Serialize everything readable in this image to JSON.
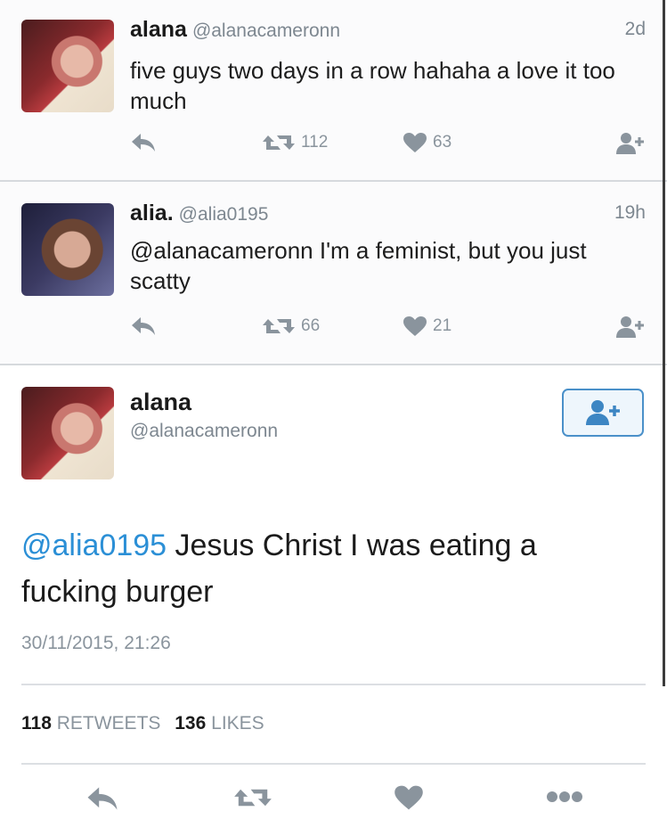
{
  "tweets": [
    {
      "name": "alana",
      "handle": "@alanacameronn",
      "time": "2d",
      "text": "five guys two days in a row hahaha a love it too much",
      "retweets": "112",
      "likes": "63"
    },
    {
      "name": "alia.",
      "handle": "@alia0195",
      "time": "19h",
      "text": "@alanacameronn I'm a feminist, but you just scatty",
      "retweets": "66",
      "likes": "21"
    }
  ],
  "detail": {
    "name": "alana",
    "handle": "@alanacameronn",
    "mention": "@alia0195",
    "text": " Jesus Christ I was eating a fucking burger",
    "date": "30/11/2015, 21:26",
    "retweet_count": "118",
    "retweet_label": "RETWEETS",
    "like_count": "136",
    "like_label": "LIKES"
  },
  "icons": {
    "reply": "reply-icon",
    "retweet": "retweet-icon",
    "like": "heart-icon",
    "follow": "follow-user-icon",
    "more": "more-icon"
  },
  "colors": {
    "link": "#2b8fd6",
    "muted": "#8a949d",
    "follow_border": "#4a90c9"
  }
}
